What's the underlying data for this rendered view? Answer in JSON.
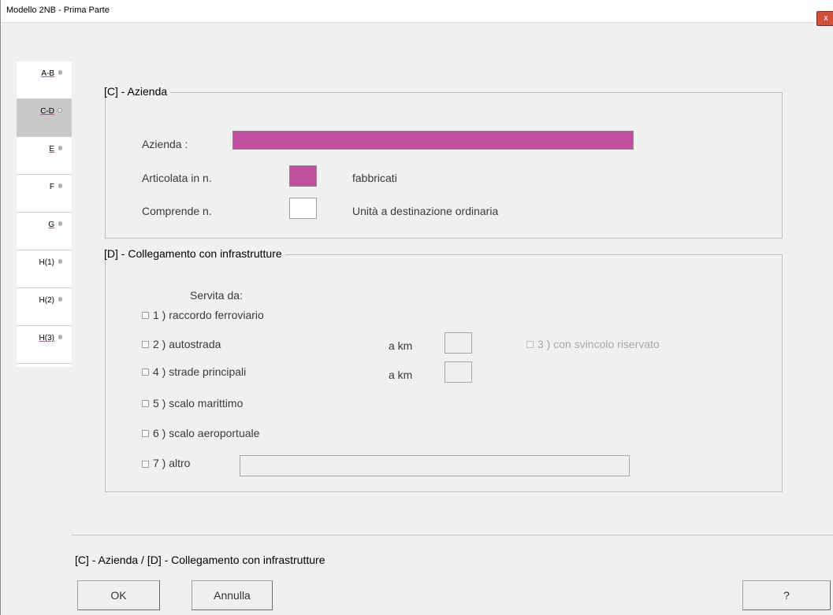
{
  "window": {
    "title": "Modello 2NB - Prima Parte",
    "close_glyph": "x"
  },
  "sidetabs": [
    {
      "label": "A-B"
    },
    {
      "label": "C-D"
    },
    {
      "label": "E"
    },
    {
      "label": "F"
    },
    {
      "label": "G"
    },
    {
      "label": "H(1)"
    },
    {
      "label": "H(2)"
    },
    {
      "label": "H(3)"
    }
  ],
  "azienda": {
    "legend": "[C] - Azienda",
    "azienda_label": "Azienda :",
    "azienda_value": "",
    "articolata_label": "Articolata in n.",
    "articolata_value": "",
    "fabbricati_label": "fabbricati",
    "comprende_label": "Comprende n.",
    "comprende_value": "",
    "unita_label": "Unità a destinazione ordinaria"
  },
  "collegamento": {
    "legend": "[D] - Collegamento con infrastrutture",
    "servita_label": "Servita da:",
    "options": {
      "raccordo": "1 ) raccordo ferroviario",
      "autostrada": "2 ) autostrada",
      "strade": "4 ) strade principali",
      "scalo_marittimo": "5 ) scalo marittimo",
      "scalo_aero": "6 ) scalo aeroportuale",
      "altro": "7 ) altro",
      "svincolo": "3 ) con svincolo riservato"
    },
    "akm_label_1": "a km",
    "akm_label_2": "a km",
    "akm_value_1": "",
    "akm_value_2": "",
    "altro_value": ""
  },
  "footer": {
    "title": "[C] - Azienda / [D] - Collegamento con infrastrutture",
    "ok_label": "OK",
    "annulla_label": "Annulla",
    "help_label": "?"
  },
  "colors": {
    "required_field": "#c0509f",
    "active_tab": "#c8c8c8"
  }
}
